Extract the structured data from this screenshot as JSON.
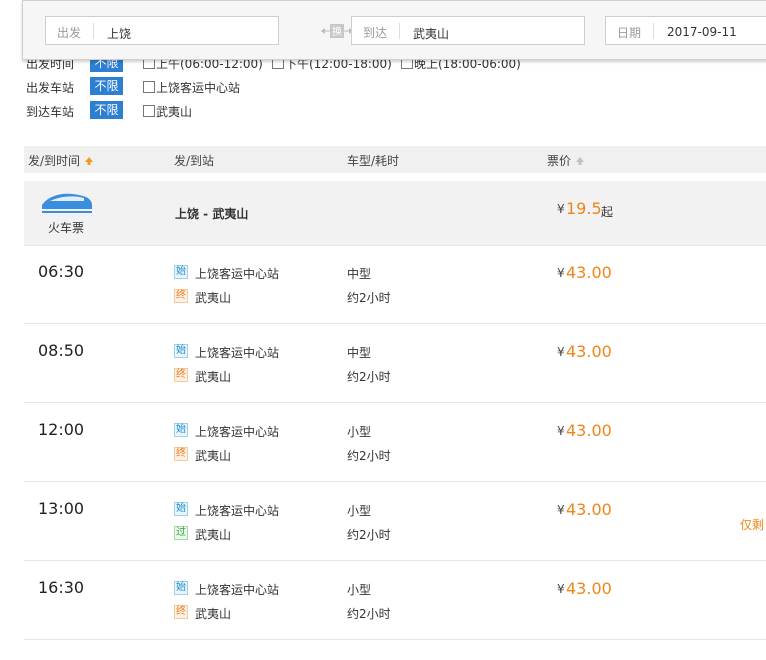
{
  "search": {
    "from_label": "出发",
    "from_value": "上饶",
    "swap_label": "换",
    "to_label": "到达",
    "to_value": "武夷山",
    "date_label": "日期",
    "date_value": "2017-09-11"
  },
  "filters": {
    "depart_time": {
      "label": "出发时间",
      "unlimited": "不限",
      "options": [
        "上午(06:00-12:00)",
        "下午(12:00-18:00)",
        "晚上(18:00-06:00)"
      ]
    },
    "depart_station": {
      "label": "出发车站",
      "unlimited": "不限",
      "options": [
        "上饶客运中心站"
      ]
    },
    "arrive_station": {
      "label": "到达车站",
      "unlimited": "不限",
      "options": [
        "武夷山"
      ]
    }
  },
  "table_header": {
    "time": "发/到时间",
    "station": "发/到站",
    "type": "车型/耗时",
    "price": "票价"
  },
  "summary": {
    "train_label": "火车票",
    "route": "上饶 - 武夷山",
    "currency": "¥",
    "price": "19.5",
    "suffix": "起"
  },
  "rows": [
    {
      "time": "06:30",
      "start_badge": "始",
      "from": "上饶客运中心站",
      "end_badge": "终",
      "to": "武夷山",
      "type": "中型",
      "duration": "约2小时",
      "currency": "¥",
      "price": "43.00"
    },
    {
      "time": "08:50",
      "start_badge": "始",
      "from": "上饶客运中心站",
      "end_badge": "终",
      "to": "武夷山",
      "type": "中型",
      "duration": "约2小时",
      "currency": "¥",
      "price": "43.00"
    },
    {
      "time": "12:00",
      "start_badge": "始",
      "from": "上饶客运中心站",
      "end_badge": "终",
      "to": "武夷山",
      "type": "小型",
      "duration": "约2小时",
      "currency": "¥",
      "price": "43.00"
    },
    {
      "time": "13:00",
      "start_badge": "始",
      "from": "上饶客运中心站",
      "end_badge": "过",
      "to": "武夷山",
      "type": "小型",
      "duration": "约2小时",
      "currency": "¥",
      "price": "43.00",
      "note": "仅剩"
    },
    {
      "time": "16:30",
      "start_badge": "始",
      "from": "上饶客运中心站",
      "end_badge": "终",
      "to": "武夷山",
      "type": "小型",
      "duration": "约2小时",
      "currency": "¥",
      "price": "43.00"
    }
  ],
  "colors": {
    "accent_blue": "#2d7fd1",
    "price_orange": "#f08519"
  }
}
